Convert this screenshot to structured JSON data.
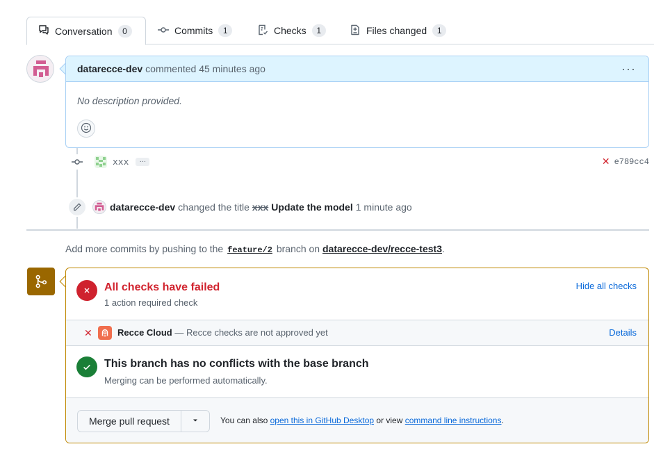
{
  "tabs": [
    {
      "label": "Conversation",
      "count": "0",
      "icon": "comment-discussion-icon"
    },
    {
      "label": "Commits",
      "count": "1",
      "icon": "git-commit-icon"
    },
    {
      "label": "Checks",
      "count": "1",
      "icon": "checklist-icon"
    },
    {
      "label": "Files changed",
      "count": "1",
      "icon": "file-diff-icon"
    }
  ],
  "comment": {
    "author": "datarecce-dev",
    "action": "commented 45 minutes ago",
    "body": "No description provided.",
    "menu": "···"
  },
  "commit": {
    "message": "xxx",
    "ellipsis": "…",
    "status": "✕",
    "sha": "e789cc4"
  },
  "rename_event": {
    "actor": "datarecce-dev",
    "action": "changed the title",
    "old_title": "xxx",
    "new_title": "Update the model",
    "time": "1 minute ago"
  },
  "hint": {
    "prefix": "Add more commits by pushing to the",
    "branch": "feature/2",
    "middle": "branch on",
    "repo": "datarecce-dev/recce-test3",
    "suffix": "."
  },
  "merge_box": {
    "checks_title": "All checks have failed",
    "checks_sub": "1 action required check",
    "hide_label": "Hide all checks",
    "check_status": "✕",
    "check_name": "Recce Cloud",
    "check_desc": "— Recce checks are not approved yet",
    "details_label": "Details",
    "conflict_title": "This branch has no conflicts with the base branch",
    "conflict_sub": "Merging can be performed automatically.",
    "merge_label": "Merge pull request",
    "also_prefix": "You can also",
    "desktop_link": "open this in GitHub Desktop",
    "also_middle": "or view",
    "cli_link": "command line instructions",
    "also_suffix": "."
  },
  "colors": {
    "accent_blue": "#0969da",
    "fail_red": "#cf222e",
    "success_green": "#1a7f37",
    "warning_brown": "#9a6700",
    "comment_header_bg": "#ddf4ff"
  }
}
